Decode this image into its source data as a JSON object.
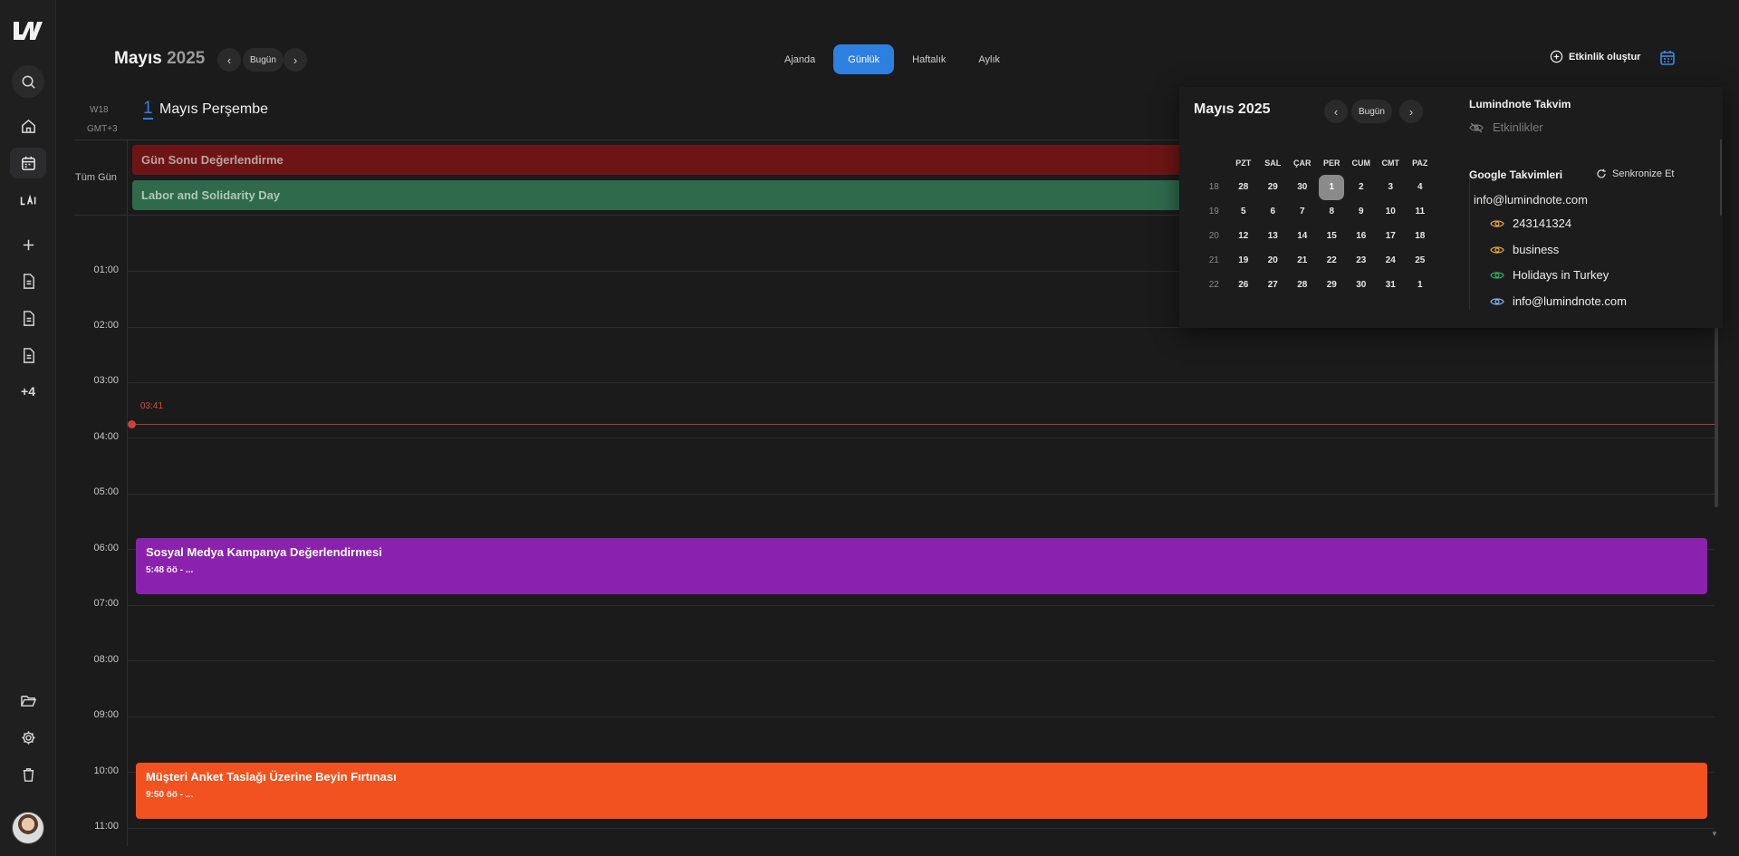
{
  "header": {
    "month": "Mayıs",
    "year": "2025",
    "today_label": "Bugün",
    "views": [
      "Ajanda",
      "Günlük",
      "Haftalık",
      "Aylık"
    ],
    "active_view": "Günlük",
    "create_label": "Etkinlik oluştur"
  },
  "day": {
    "week": "W18",
    "tz": "GMT+3",
    "number": "1",
    "label": "Mayıs Perşembe",
    "all_day_label": "Tüm Gün"
  },
  "all_day_events": [
    {
      "title": "Gün Sonu Değerlendirme",
      "color": "#6d1515"
    },
    {
      "title": "Labor and Solidarity Day",
      "color": "#2f6a4d"
    }
  ],
  "hours": [
    "01:00",
    "02:00",
    "03:00",
    "04:00",
    "05:00",
    "06:00",
    "07:00",
    "08:00",
    "09:00",
    "10:00",
    "11:00"
  ],
  "now_label": "03:41",
  "events": [
    {
      "title": "Sosyal Medya Kampanya Değerlendirmesi",
      "time": "5:48 öö - ...",
      "color": "#8a22ad"
    },
    {
      "title": "Müşteri Anket Taslağı Üzerine Beyin Fırtınası",
      "time": "9:50 öö - ...",
      "color": "#f2521f"
    }
  ],
  "rail": {
    "more": "+4"
  },
  "mini_calendar": {
    "title": "Mayıs 2025",
    "today_label": "Bugün",
    "dow": [
      "PZT",
      "SAL",
      "ÇAR",
      "PER",
      "CUM",
      "CMT",
      "PAZ"
    ],
    "weeks": [
      {
        "wk": "18",
        "days": [
          "28",
          "29",
          "30",
          "1",
          "2",
          "3",
          "4"
        ]
      },
      {
        "wk": "19",
        "days": [
          "5",
          "6",
          "7",
          "8",
          "9",
          "10",
          "11"
        ]
      },
      {
        "wk": "20",
        "days": [
          "12",
          "13",
          "14",
          "15",
          "16",
          "17",
          "18"
        ]
      },
      {
        "wk": "21",
        "days": [
          "19",
          "20",
          "21",
          "22",
          "23",
          "24",
          "25"
        ]
      },
      {
        "wk": "22",
        "days": [
          "26",
          "27",
          "28",
          "29",
          "30",
          "31",
          "1"
        ]
      }
    ],
    "selected": "1"
  },
  "calendars": {
    "lumindnote_title": "Lumindnote Takvim",
    "lumindnote_item": "Etkinlikler",
    "google_title": "Google Takvimleri",
    "sync_label": "Senkronize Et",
    "account": "info@lumindnote.com",
    "items": [
      {
        "name": "243141324",
        "color": "#e6a23c"
      },
      {
        "name": "business",
        "color": "#e6a23c"
      },
      {
        "name": "Holidays in Turkey",
        "color": "#2fae6b"
      },
      {
        "name": "info@lumindnote.com",
        "color": "#7fb3e6"
      }
    ]
  }
}
